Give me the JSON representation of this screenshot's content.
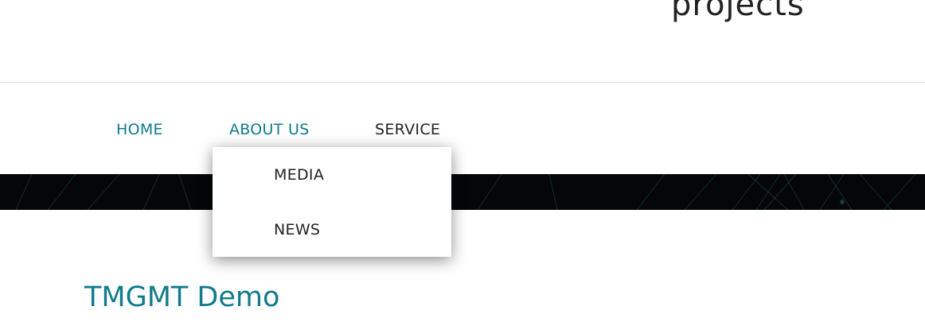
{
  "header": {
    "tagline_fragment": "projects"
  },
  "nav": {
    "items": [
      {
        "label": "HOME"
      },
      {
        "label": "ABOUT US"
      },
      {
        "label": "SERVICE"
      }
    ],
    "dropdown": {
      "items": [
        {
          "label": "MEDIA"
        },
        {
          "label": "NEWS"
        }
      ]
    }
  },
  "main": {
    "title": "TMGMT Demo"
  },
  "colors": {
    "accent": "#117a8b",
    "text": "#222222",
    "banner": "#040607",
    "divider": "#dedede"
  }
}
